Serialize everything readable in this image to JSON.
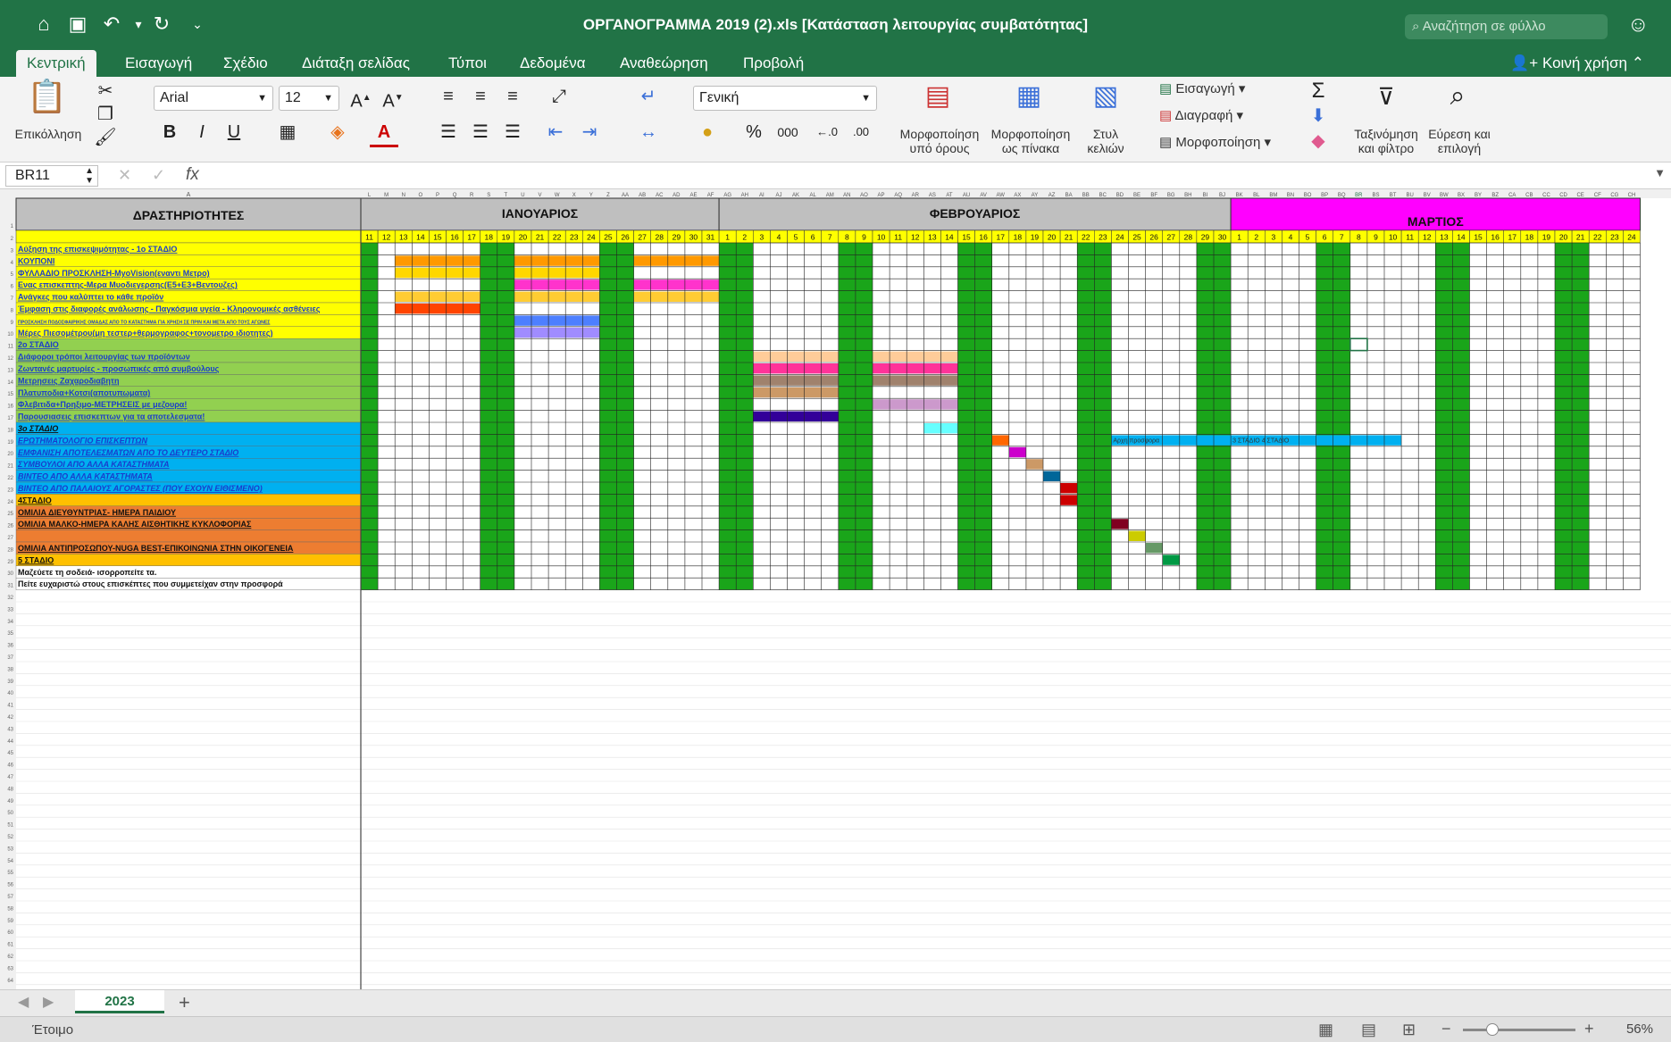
{
  "window": {
    "title": "ΟΡΓΑΝΟΓΡΑΜΜΑ 2019 (2).xls  [Κατάσταση λειτουργίας συμβατότητας]",
    "search_placeholder": "Αναζήτηση σε φύλλο"
  },
  "ribbon_tabs": [
    "Κεντρική",
    "Εισαγωγή",
    "Σχέδιο",
    "Διάταξη σελίδας",
    "Τύποι",
    "Δεδομένα",
    "Αναθεώρηση",
    "Προβολή"
  ],
  "active_tab": "Κεντρική",
  "share_label": "Κοινή χρήση",
  "ribbon": {
    "paste": "Επικόλληση",
    "font": "Arial",
    "font_size": "12",
    "number_format": "Γενική",
    "percent": "%",
    "thousands": "000",
    "cond_format": [
      "Μορφοποίηση",
      "υπό όρους"
    ],
    "table_format": [
      "Μορφοποίηση",
      "ως πίνακα"
    ],
    "cell_styles": [
      "Στυλ",
      "κελιών"
    ],
    "insert": "Εισαγωγή",
    "delete": "Διαγραφή",
    "format": "Μορφοποίηση",
    "sort_filter": [
      "Ταξινόμηση",
      "και φίλτρο"
    ],
    "find": [
      "Εύρεση και",
      "επιλογή"
    ]
  },
  "formula_bar": {
    "cell_ref": "BR11",
    "fx": "fx",
    "content": ""
  },
  "sheet": {
    "col_a_header": "Α",
    "activities_header": "ΔΡΑΣΤΗΡΙΟΤΗΤΕΣ",
    "months": [
      {
        "name": "ΙΑΝΟΥΑΡΙΟΣ",
        "color": "#bfbfbf"
      },
      {
        "name": "ΦΕΒΡΟΥΑΡΙΟΣ",
        "color": "#bfbfbf"
      },
      {
        "name": "ΜΑΡΤΙΟΣ",
        "color": "#ff00ff"
      }
    ],
    "day_header_color": "#ffff00",
    "weekend_color": "#1aa51a",
    "days": [
      "11",
      "12",
      "13",
      "14",
      "15",
      "16",
      "17",
      "18",
      "19",
      "20",
      "21",
      "22",
      "23",
      "24",
      "25",
      "26",
      "27",
      "28",
      "29",
      "30",
      "31",
      "1",
      "2",
      "3",
      "4",
      "5",
      "6",
      "7",
      "8",
      "9",
      "10",
      "11",
      "12",
      "13",
      "14",
      "15",
      "16",
      "17",
      "18",
      "19",
      "20",
      "21",
      "22",
      "23",
      "24",
      "25",
      "26",
      "27",
      "28",
      "29",
      "30",
      "1",
      "2",
      "3",
      "4",
      "5",
      "6",
      "7",
      "8",
      "9",
      "10",
      "11",
      "12",
      "13",
      "14",
      "15",
      "16",
      "17",
      "18",
      "19",
      "20",
      "21",
      "22",
      "23",
      "24"
    ],
    "col_letters": [
      "L",
      "M",
      "N",
      "O",
      "P",
      "Q",
      "R",
      "S",
      "T",
      "U",
      "V",
      "W",
      "X",
      "Y",
      "Z",
      "AA",
      "AB",
      "AC",
      "AD",
      "AE",
      "AF",
      "AG",
      "AH",
      "AI",
      "AJ",
      "AK",
      "AL",
      "AM",
      "AN",
      "AO",
      "AP",
      "AQ",
      "AR",
      "AS",
      "AT",
      "AU",
      "AV",
      "AW",
      "AX",
      "AY",
      "AZ",
      "BA",
      "BB",
      "BC",
      "BD",
      "BE",
      "BF",
      "BG",
      "BH",
      "BI",
      "BJ",
      "BK",
      "BL",
      "BM",
      "BN",
      "BO",
      "BP",
      "BQ",
      "BR",
      "BS",
      "BT",
      "BU",
      "BV",
      "BW",
      "BX",
      "BY",
      "BZ",
      "CA",
      "CB",
      "CC",
      "CD",
      "CE",
      "CF",
      "CG",
      "CH"
    ],
    "weekend_idx": [
      0,
      7,
      8,
      14,
      15,
      21,
      22,
      28,
      29,
      35,
      36,
      42,
      43,
      49,
      50,
      56,
      57,
      63,
      64,
      70,
      71
    ],
    "rows": [
      {
        "text": "Αύξηση της επισκεψιμότητας - 1ο ΣΤΑΔΙΟ",
        "bg": "#ffff00",
        "color": "#1a3ccc",
        "bars": []
      },
      {
        "text": "ΚΟΥΠΟΝΙ",
        "bg": "#ffff00",
        "color": "#1a3ccc",
        "bars": [
          {
            "s": 2,
            "e": 6,
            "c": "#ff9900"
          },
          {
            "s": 9,
            "e": 13,
            "c": "#ff9900"
          },
          {
            "s": 16,
            "e": 20,
            "c": "#ff9900"
          }
        ]
      },
      {
        "text": "ΦΥΛΛΑΔΙΟ ΠΡΟΣΚΛΗΣΗ-MyoVision(εναντι Μετρο)",
        "bg": "#ffff00",
        "color": "#1a3ccc",
        "bars": [
          {
            "s": 2,
            "e": 6,
            "c": "#ffd700"
          },
          {
            "s": 9,
            "e": 13,
            "c": "#ffd700"
          }
        ]
      },
      {
        "text": "Ενας επισκεπτης-Μερα Μυοδιεγερσης(Ε5+Ε3+Βεντουζες)",
        "bg": "#ffff00",
        "color": "#1a3ccc",
        "bars": [
          {
            "s": 9,
            "e": 13,
            "c": "#ff33cc"
          },
          {
            "s": 16,
            "e": 20,
            "c": "#ff33cc"
          }
        ]
      },
      {
        "text": "Ανάγκες που καλύπτει το κάθε προϊόν",
        "bg": "#ffff00",
        "color": "#1a3ccc",
        "bars": [
          {
            "s": 2,
            "e": 6,
            "c": "#ffcc33"
          },
          {
            "s": 9,
            "e": 13,
            "c": "#ffcc33"
          },
          {
            "s": 16,
            "e": 20,
            "c": "#ffcc33"
          }
        ]
      },
      {
        "text": "Έμφαση στις διαφορές ανάλωσης - Παγκόσμια υγεία - Κληρονομικές ασθένειες",
        "bg": "#ffff00",
        "color": "#1a3ccc",
        "bars": [
          {
            "s": 2,
            "e": 6,
            "c": "#ff4400"
          }
        ]
      },
      {
        "text": "ΠΡΟΣΚΛΗΣΗ ΠΟΔΟΣΦΑΙΡΙΚΗΣ ΟΜΑΔΑΣ ΑΠΟ ΤΟ ΚΑΤΑΣΤΗΜΑ ΓΙΑ ΧΡΗΣΗ ΣΕ ΠΡΙΝ ΚΑΙ ΜΕΤΑ ΑΠΟ ΤΟΥΣ ΑΓΩΝΕΣ",
        "bg": "#ffff00",
        "color": "#1a3ccc",
        "bars": [
          {
            "s": 9,
            "e": 13,
            "c": "#4d7fff"
          }
        ]
      },
      {
        "text": "Μέρες Πιεσομέτρου(μη τεστερ+θερμογραφος+τονομετρο ιδιοτητες)",
        "bg": "#ffff00",
        "color": "#1a3ccc",
        "bars": [
          {
            "s": 9,
            "e": 13,
            "c": "#a08cff"
          }
        ]
      },
      {
        "text": "2ο ΣΤΑΔΙΟ",
        "bg": "#92d050",
        "color": "#1a3ccc",
        "bars": []
      },
      {
        "text": "Διάφοροι τρόποι λειτουργίας των προϊόντων",
        "bg": "#92d050",
        "color": "#1a3ccc",
        "bars": [
          {
            "s": 23,
            "e": 27,
            "c": "#ffcc99"
          },
          {
            "s": 30,
            "e": 34,
            "c": "#ffcc99"
          }
        ]
      },
      {
        "text": "Ζωντανές μαρτυρίες - προσωπικές από συμβούλους",
        "bg": "#92d050",
        "color": "#1a3ccc",
        "bars": [
          {
            "s": 23,
            "e": 27,
            "c": "#ff3399"
          },
          {
            "s": 30,
            "e": 34,
            "c": "#ff3399"
          }
        ]
      },
      {
        "text": "Μετρησεις Ζαχαροδιαβητη",
        "bg": "#92d050",
        "color": "#1a3ccc",
        "bars": [
          {
            "s": 23,
            "e": 27,
            "c": "#a0826d"
          },
          {
            "s": 30,
            "e": 34,
            "c": "#a0826d"
          }
        ]
      },
      {
        "text": "Πλατυποδια+Κοτσι(αποτυπωματα)",
        "bg": "#92d050",
        "color": "#1a3ccc",
        "bars": [
          {
            "s": 23,
            "e": 27,
            "c": "#cc9966"
          }
        ]
      },
      {
        "text": "Φλεβιτιδα+Πρηξιμο-ΜΕΤΡΗΣΕΙΣ με μεζουρα!",
        "bg": "#92d050",
        "color": "#1a3ccc",
        "bars": [
          {
            "s": 30,
            "e": 34,
            "c": "#cc99cc"
          }
        ]
      },
      {
        "text": "Παρουσιασεις επισκεπτων για τα αποτελεσματα!",
        "bg": "#92d050",
        "color": "#1a3ccc",
        "bars": [
          {
            "s": 23,
            "e": 27,
            "c": "#330099"
          }
        ]
      },
      {
        "text": "3ο ΣΤΑΔΙΟ",
        "bg": "#00b0f0",
        "color": "#111111",
        "bars": [
          {
            "s": 33,
            "e": 34,
            "c": "#66ffff"
          }
        ]
      },
      {
        "text": "ΕΡΩΤΗΜΑΤΟΛΟΓΙΟ ΕΠΙΣΚΕΠΤΩΝ",
        "bg": "#00b0f0",
        "color": "#1a3ccc",
        "bars": [
          {
            "s": 37,
            "e": 37,
            "c": "#ff6600"
          },
          {
            "s": 44,
            "e": 60,
            "c": "#00b0f0"
          }
        ]
      },
      {
        "text": "ΕΜΦΑΝΙΣΗ ΑΠΟΤΕΛΕΣΜΑΤΩΝ ΑΠΟ ΤΟ ΔΕΥΤΕΡΟ ΣΤΑΔΙΟ",
        "bg": "#00b0f0",
        "color": "#1a3ccc",
        "bars": [
          {
            "s": 38,
            "e": 38,
            "c": "#cc00cc"
          }
        ]
      },
      {
        "text": "ΣΥΜΒΟΥΛΟΙ ΑΠΟ ΑΛΛΑ ΚΑΤΑΣΤΗΜΑΤΑ",
        "bg": "#00b0f0",
        "color": "#1a3ccc",
        "bars": [
          {
            "s": 39,
            "e": 39,
            "c": "#cc9966"
          }
        ]
      },
      {
        "text": "ΒΙΝΤΕΟ ΑΠΟ ΑΛΛΑ ΚΑΤΑΣΤΗΜΑΤΑ",
        "bg": "#00b0f0",
        "color": "#1a3ccc",
        "bars": [
          {
            "s": 40,
            "e": 40,
            "c": "#006699"
          }
        ]
      },
      {
        "text": "ΒΙΝΤΕΟ ΑΠΟ ΠΑΛΑΙΟΥΣ ΑΓΟΡΑΣΤΕΣ (ΠΟΥ ΕΧΟΥΝ ΕΙΘΙΣΜΕΝΟ)",
        "bg": "#00b0f0",
        "color": "#1a3ccc",
        "bars": [
          {
            "s": 41,
            "e": 41,
            "c": "#cc0000"
          }
        ]
      },
      {
        "text": "4ΣΤΑΔΙΟ",
        "bg": "#ffc000",
        "color": "#111111",
        "bars": [
          {
            "s": 41,
            "e": 41,
            "c": "#cc0000"
          }
        ]
      },
      {
        "text": "ΟΜΙΛΙΑ ΔΙΕΥΘΥΝΤΡΙΑΣ- ΗΜΕΡΑ ΠΑΙΔΙΟΥ",
        "bg": "#ed7d31",
        "color": "#111111",
        "bars": []
      },
      {
        "text": "ΟΜΙΛΙΑ ΜΑΛΚΟ-ΗΜΕΡΑ ΚΑΛΗΣ ΑΙΣΘΗΤΙΚΗΣ ΚΥΚΛΟΦΟΡΙΑΣ",
        "bg": "#ed7d31",
        "color": "#111111",
        "bars": [
          {
            "s": 44,
            "e": 44,
            "c": "#800020"
          }
        ]
      },
      {
        "text": "",
        "bg": "#ed7d31",
        "color": "#111111",
        "bars": [
          {
            "s": 45,
            "e": 45,
            "c": "#cccc00"
          }
        ]
      },
      {
        "text": "ΟΜΙΛΙΑ ΑΝΤΙΠΡΟΣΩΠΟΥ-NUGA BEST-ΕΠΙΚΟΙΝΩΝΙΑ ΣΤΗΝ ΟΙΚΟΓΕΝΕΙΑ",
        "bg": "#ed7d31",
        "color": "#111111",
        "bars": [
          {
            "s": 46,
            "e": 46,
            "c": "#669966"
          }
        ]
      },
      {
        "text": "5 ΣΤΑΔΙΟ",
        "bg": "#ffc000",
        "color": "#111111",
        "bars": [
          {
            "s": 47,
            "e": 47,
            "c": "#009944"
          }
        ]
      },
      {
        "text": "Μαζεύετε τη σοδειά- ισορροπείτε τα.",
        "bg": "#ffffff",
        "color": "#111111",
        "bars": []
      },
      {
        "text": "Πείτε ευχαριστώ στους επισκέπτες που συμμετείχαν στην προσφορά",
        "bg": "#ffffff",
        "color": "#111111",
        "bars": []
      }
    ],
    "band_labels": [
      {
        "row": 16,
        "col": 44,
        "text": "Αρχη προσφορα"
      },
      {
        "row": 16,
        "col": 51,
        "text": "3 ΣΤΑΔΙΟ 4 ΣΤΑΔΙΟ"
      }
    ],
    "total_rows": 66
  },
  "sheet_tab": "2023",
  "status": "Έτοιμο",
  "zoom": "56%"
}
